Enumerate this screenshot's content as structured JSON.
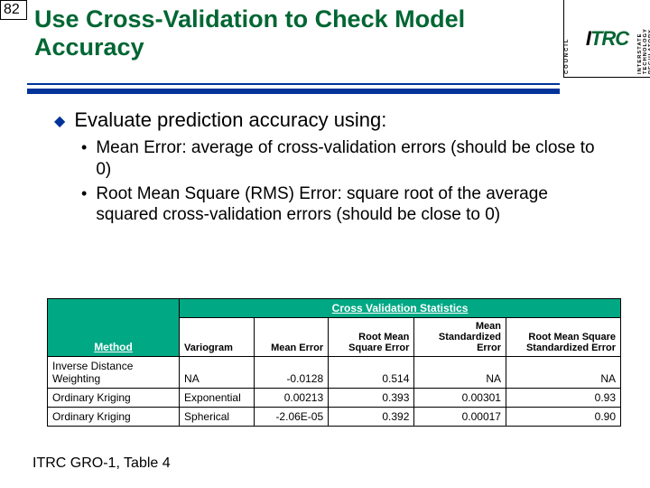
{
  "page_number": "82",
  "title": "Use Cross-Validation to Check Model Accuracy",
  "logo": {
    "left_top": "COUNCIL",
    "core": "ITRC",
    "right_top": "INTERSTATE",
    "right_bottom": "TECHNOLOGY",
    "right_mid": "REGULATORY"
  },
  "bullets": {
    "lvl1": "Evaluate prediction accuracy using:",
    "lvl2a": "Mean Error: average of cross-validation errors (should be close to 0)",
    "lvl2b": "Root Mean Square (RMS) Error: square root of the average squared cross-validation errors (should be close to 0)"
  },
  "table": {
    "span_header": "Cross Validation Statistics",
    "cols": {
      "method": "Method",
      "vario": "Variogram",
      "me": "Mean Error",
      "rmse": "Root Mean Square Error",
      "mse": "Mean Standardized Error",
      "rmsse": "Root Mean Square Standardized Error"
    },
    "rows": [
      {
        "method": "Inverse Distance Weighting",
        "vario": "NA",
        "me": "-0.0128",
        "rmse": "0.514",
        "mse": "NA",
        "rmsse": "NA"
      },
      {
        "method": "Ordinary Kriging",
        "vario": "Exponential",
        "me": "0.00213",
        "rmse": "0.393",
        "mse": "0.00301",
        "rmsse": "0.93"
      },
      {
        "method": "Ordinary Kriging",
        "vario": "Spherical",
        "me": "-2.06E-05",
        "rmse": "0.392",
        "mse": "0.00017",
        "rmsse": "0.90"
      }
    ]
  },
  "source": "ITRC GRO-1, Table 4",
  "chart_data": {
    "type": "table",
    "title": "Cross Validation Statistics",
    "columns": [
      "Method",
      "Variogram",
      "Mean Error",
      "Root Mean Square Error",
      "Mean Standardized Error",
      "Root Mean Square Standardized Error"
    ],
    "rows": [
      [
        "Inverse Distance Weighting",
        "NA",
        -0.0128,
        0.514,
        "NA",
        "NA"
      ],
      [
        "Ordinary Kriging",
        "Exponential",
        0.00213,
        0.393,
        0.00301,
        0.93
      ],
      [
        "Ordinary Kriging",
        "Spherical",
        -2.06e-05,
        0.392,
        0.00017,
        0.9
      ]
    ]
  }
}
